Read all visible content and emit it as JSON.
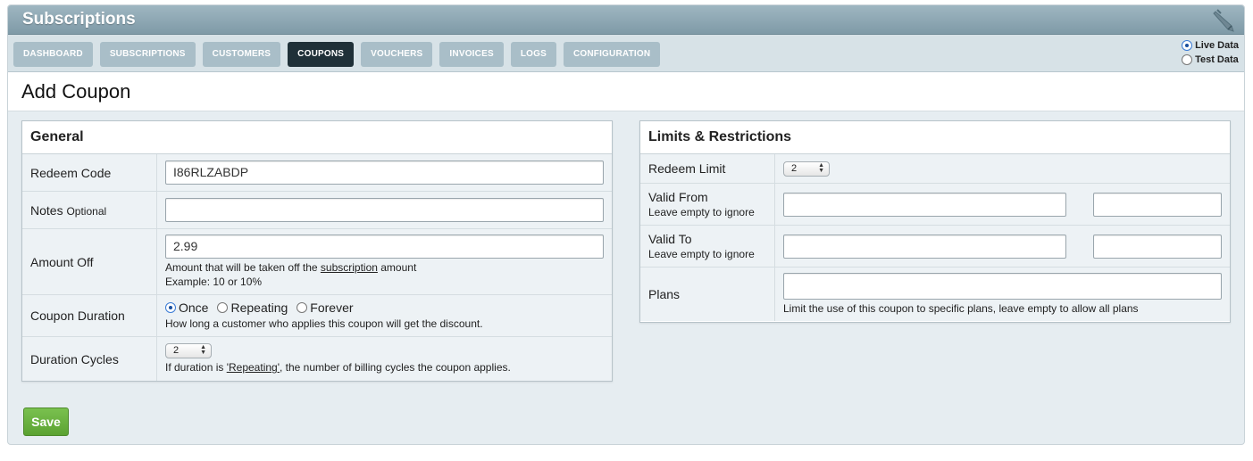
{
  "app": {
    "title": "Subscriptions"
  },
  "nav": {
    "tabs": [
      {
        "label": "DASHBOARD"
      },
      {
        "label": "SUBSCRIPTIONS"
      },
      {
        "label": "CUSTOMERS"
      },
      {
        "label": "COUPONS"
      },
      {
        "label": "VOUCHERS"
      },
      {
        "label": "INVOICES"
      },
      {
        "label": "LOGS"
      },
      {
        "label": "CONFIGURATION"
      }
    ],
    "active_tab": "COUPONS"
  },
  "data_mode": {
    "live_label": "Live Data",
    "test_label": "Test Data",
    "selected": "Live Data"
  },
  "page": {
    "title": "Add Coupon"
  },
  "general": {
    "heading": "General",
    "redeem_code": {
      "label": "Redeem Code",
      "value": "I86RLZABDP"
    },
    "notes": {
      "label": "Notes",
      "optional": "Optional",
      "value": ""
    },
    "amount_off": {
      "label": "Amount Off",
      "value": "2.99",
      "help_prefix": "Amount that will be taken off the ",
      "help_link": "subscription",
      "help_suffix": " amount",
      "example": "Example: 10 or 10%"
    },
    "coupon_duration": {
      "label": "Coupon Duration",
      "options": [
        "Once",
        "Repeating",
        "Forever"
      ],
      "selected": "Once",
      "help": "How long a customer who applies this coupon will get the discount."
    },
    "duration_cycles": {
      "label": "Duration Cycles",
      "value": "2",
      "help_prefix": "If duration is ",
      "help_link": "'Repeating'",
      "help_suffix": ", the number of billing cycles the coupon applies."
    }
  },
  "limits": {
    "heading": "Limits & Restrictions",
    "redeem_limit": {
      "label": "Redeem Limit",
      "value": "2"
    },
    "valid_from": {
      "label": "Valid From",
      "sub": "Leave empty to ignore",
      "date": "",
      "time": ""
    },
    "valid_to": {
      "label": "Valid To",
      "sub": "Leave empty to ignore",
      "date": "",
      "time": ""
    },
    "plans": {
      "label": "Plans",
      "value": "",
      "help": "Limit the use of this coupon to specific plans, leave empty to allow all plans"
    }
  },
  "actions": {
    "save_label": "Save"
  },
  "colors": {
    "accent_save": "#5ba232",
    "active_tab": "#1f3038",
    "tab": "#a9bec8",
    "titlebar": "#8ea8b4"
  }
}
